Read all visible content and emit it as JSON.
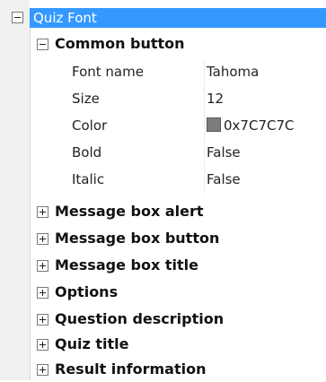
{
  "tree": {
    "root_label": "Quiz Font",
    "expanded_group": {
      "label": "Common button",
      "properties": [
        {
          "name": "Font name",
          "value": "Tahoma"
        },
        {
          "name": "Size",
          "value": "12"
        },
        {
          "name": "Color",
          "value": "0x7C7C7C",
          "swatch_color": "#7c7c7c"
        },
        {
          "name": "Bold",
          "value": "False"
        },
        {
          "name": "Italic",
          "value": "False"
        }
      ]
    },
    "collapsed_groups": [
      {
        "label": "Message box alert"
      },
      {
        "label": "Message box button"
      },
      {
        "label": "Message box title"
      },
      {
        "label": "Options"
      },
      {
        "label": "Question description"
      },
      {
        "label": "Quiz title"
      },
      {
        "label": "Result information"
      }
    ]
  },
  "colors": {
    "selection": "#3399ff",
    "gutter": "#f0f0f0"
  }
}
